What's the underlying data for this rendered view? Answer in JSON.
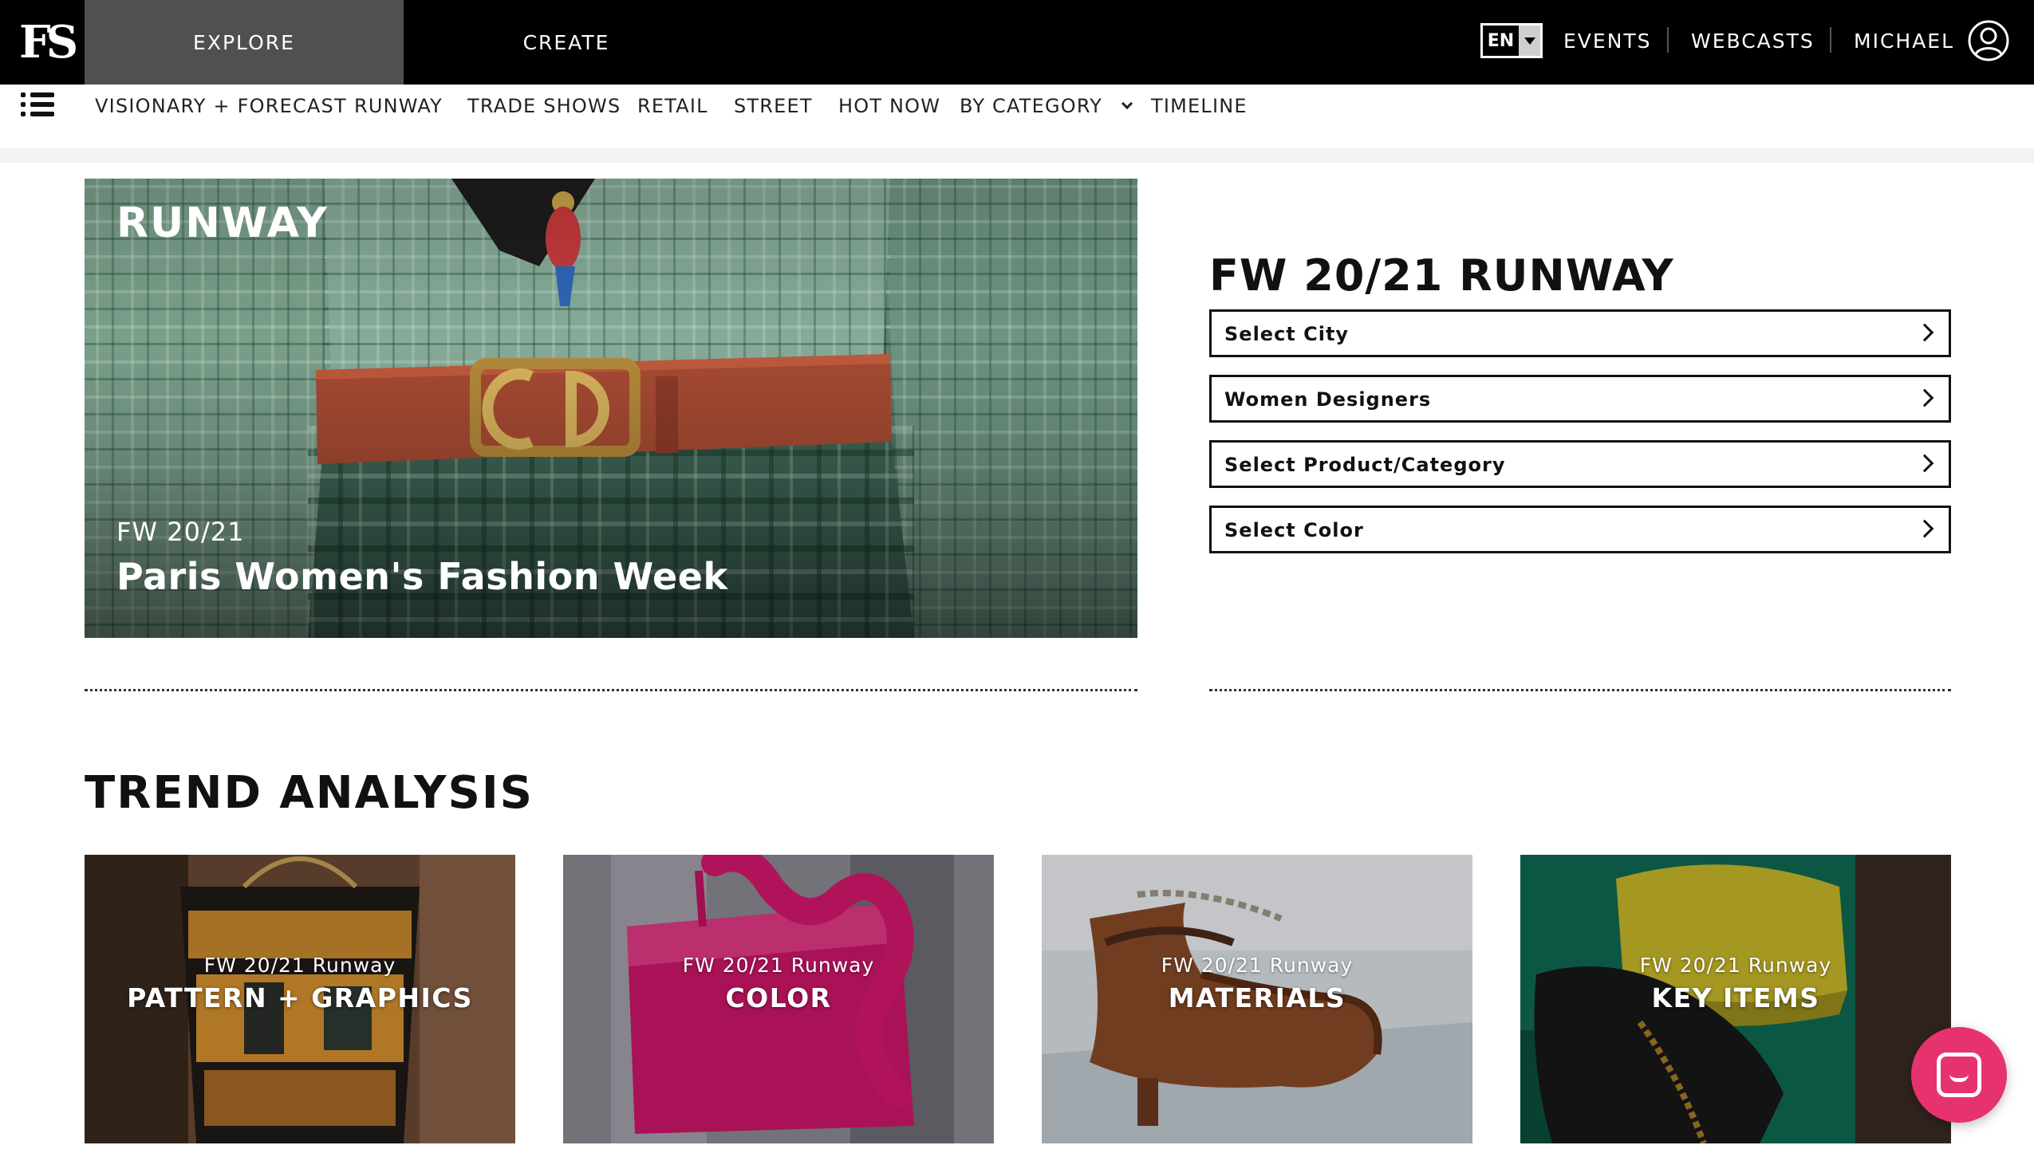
{
  "topbar": {
    "logo_text": "FS",
    "tabs": [
      {
        "label": "EXPLORE",
        "active": true
      },
      {
        "label": "CREATE",
        "active": false
      }
    ],
    "language": "EN",
    "links": [
      "EVENTS",
      "WEBCASTS",
      "MICHAEL"
    ],
    "user_icon": "user-circle-icon"
  },
  "subnav": {
    "menu_icon": "list-menu-icon",
    "items": [
      "VISIONARY + FORECAST",
      "RUNWAY",
      "TRADE SHOWS",
      "RETAIL",
      "STREET",
      "HOT NOW",
      "BY CATEGORY",
      "TIMELINE"
    ]
  },
  "hero": {
    "label": "RUNWAY",
    "season": "FW 20/21",
    "title": "Paris Women's Fashion Week"
  },
  "panel": {
    "title": "FW 20/21 RUNWAY",
    "selects": [
      "Select City",
      "Women Designers",
      "Select Product/Category",
      "Select Color"
    ]
  },
  "trend": {
    "title": "TREND ANALYSIS",
    "cards": [
      {
        "sub": "FW 20/21 Runway",
        "main": "PATTERN + GRAPHICS"
      },
      {
        "sub": "FW 20/21 Runway",
        "main": "COLOR"
      },
      {
        "sub": "FW 20/21 Runway",
        "main": "MATERIALS"
      },
      {
        "sub": "FW 20/21 Runway",
        "main": "KEY ITEMS"
      }
    ]
  },
  "chat": {
    "icon": "chat-bubble-icon"
  },
  "colors": {
    "topbar_bg": "#000000",
    "active_tab_bg": "#505050",
    "chat_accent": "#e6336e",
    "text": "#111111"
  }
}
